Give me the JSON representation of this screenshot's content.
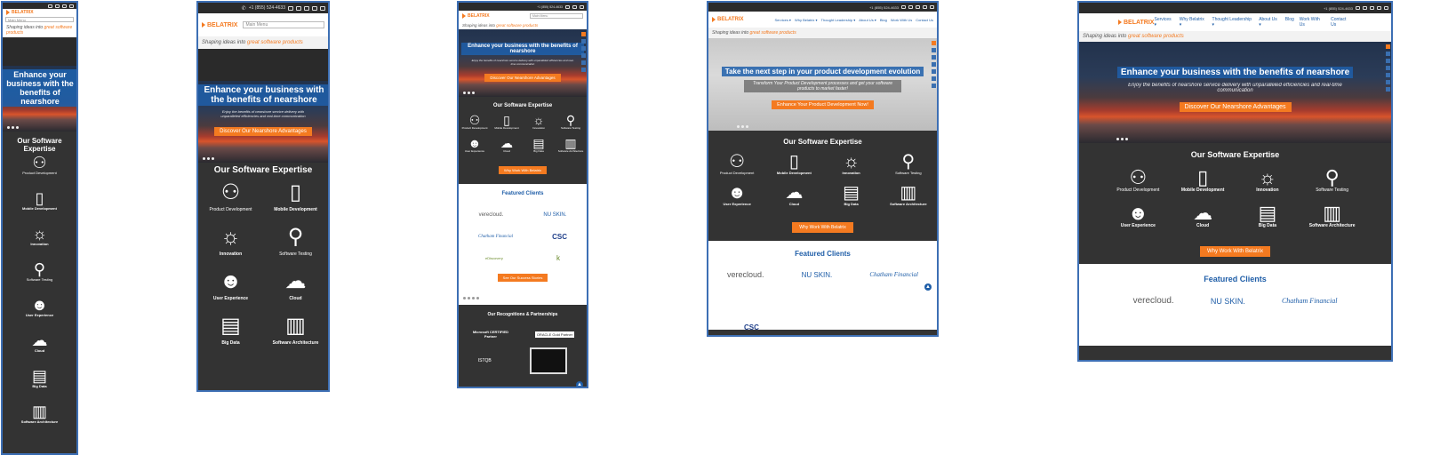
{
  "common": {
    "phone": "+1 (855) 524-4633",
    "logo_text": "BELATRIX",
    "menu_placeholder": "Main Menu",
    "tagline_prefix": "Shaping ideas into ",
    "tagline_highlight": "great software products",
    "hero_title": "Enhance your business with the benefits of nearshore",
    "hero_subtitle": "Enjoy the benefits of nearshore service delivery with unparalleled efficiencies and real-time communication",
    "hero_button": "Discover Our Nearshore Advantages",
    "expertise_title": "Our Software Expertise",
    "why_button": "Why Work With Belatrix",
    "featured_title": "Featured Clients",
    "clients_button": "See Our Success Stories",
    "recognitions_title": "Our Recognitions & Partnerships"
  },
  "nav": [
    "Services ▾",
    "Why Belatrix ▾",
    "Thought Leadership ▾",
    "About Us ▾",
    "Blog",
    "Work With Us",
    "Contact Us"
  ],
  "services": [
    {
      "label": "Product Development",
      "icon": "product-development-icon",
      "glyph": "⚇"
    },
    {
      "label": "Mobile Development",
      "icon": "mobile-icon",
      "glyph": "▯"
    },
    {
      "label": "Innovation",
      "icon": "lightbulb-icon",
      "glyph": "☼"
    },
    {
      "label": "Software Testing",
      "icon": "search-icon",
      "glyph": "⚲"
    },
    {
      "label": "User Experience",
      "icon": "users-icon",
      "glyph": "☻"
    },
    {
      "label": "Cloud",
      "icon": "cloud-icon",
      "glyph": "☁"
    },
    {
      "label": "Big Data",
      "icon": "big-data-icon",
      "glyph": "▤"
    },
    {
      "label": "Software Architecture",
      "icon": "architecture-icon",
      "glyph": "▥"
    }
  ],
  "client_logos": [
    "verecloud.",
    "NU SKIN.",
    "Chatham Financial",
    "CSC",
    "eDiscovery",
    "k"
  ],
  "partners": [
    "Microsoft CERTIFIED Partner",
    "ORACLE Gold Partner",
    "ISTQB"
  ],
  "frames": {
    "f4": {
      "hero_title": "Take the next step in your product development evolution",
      "hero_subtitle": "Transform Your Product Development processes and get your software products to market faster!",
      "hero_button": "Enhance Your Product Development Now!"
    }
  },
  "colors": {
    "accent": "#f47a20",
    "brand_blue": "#1f5ea8",
    "frame_border": "#3d6fb4",
    "dark_bg": "#333333"
  }
}
